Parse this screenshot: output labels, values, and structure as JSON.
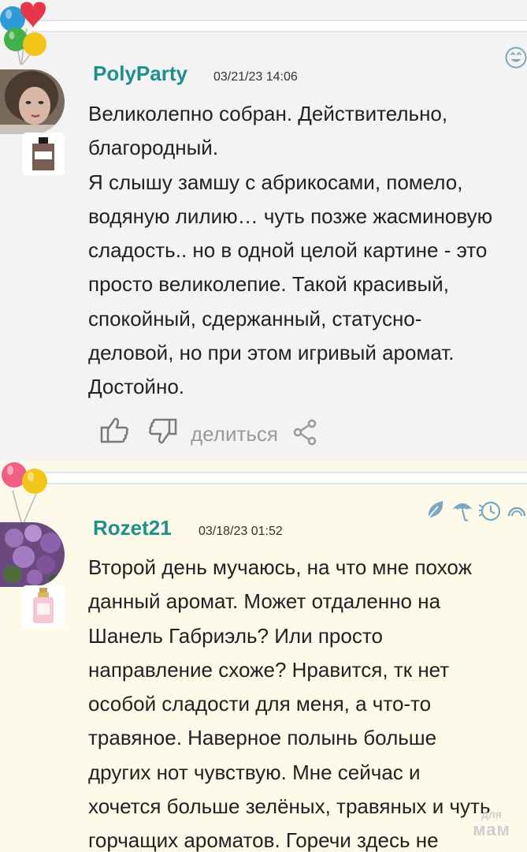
{
  "reviews": [
    {
      "username": "PolyParty",
      "timestamp": "03/21/23 14:06",
      "lines": [
        "Великолепно собран. Действительно,",
        "благородный.",
        "Я слышу замшу с абрикосами, помело,",
        "водяную лилию… чуть позже жасминовую",
        "сладость.. но в одной целой картине - это",
        "просто великолепие. Такой красивый,",
        "спокойный, сдержанный, статусно-",
        "деловой, но при этом игривый аромат.",
        "Достойно."
      ],
      "share_label": "делиться",
      "icons": [
        "balloons-icon",
        "avatar-photo",
        "perfume-bottle-icon",
        "smiley-icon",
        "thumbs-up-icon",
        "thumbs-down-icon",
        "share-icon"
      ]
    },
    {
      "username": "Rozet21",
      "timestamp": "03/18/23 01:52",
      "lines": [
        "Второй день мучаюсь, на что мне похож",
        "данный аромат. Может отдаленно на",
        "Шанель Габриэль? Или просто",
        "направление схоже? Нравится, тк нет",
        "особой сладости для меня, а что-то",
        "травяное. Наверное полынь больше",
        "других нот чувствую. Мне сейчас и",
        "хочется больше зелёных, травяных и чуть",
        "горчащих ароматов. Горечи здесь не"
      ],
      "icons": [
        "balloons-icon",
        "avatar-photo",
        "perfume-bottle-icon",
        "leaf-icon",
        "umbrella-icon",
        "clock-icon",
        "sunrise-icon"
      ]
    }
  ],
  "watermark": {
    "line1": "для",
    "line2": "мам"
  },
  "colors": {
    "username": "#1f8f8c",
    "icon": "#7aa7c2",
    "divider": "#dde7ee"
  }
}
